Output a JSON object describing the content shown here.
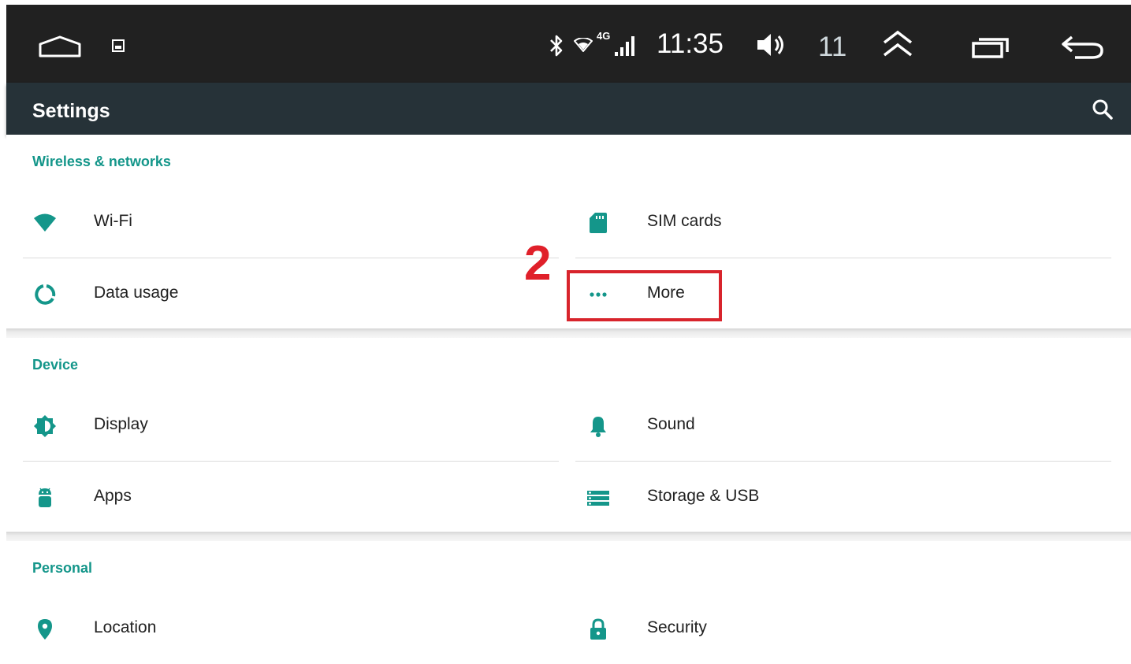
{
  "status_bar": {
    "time": "11:35",
    "network": "4G",
    "volume": "11",
    "icons": [
      "home-icon",
      "image-notification-icon",
      "bluetooth-icon",
      "wifi-icon",
      "cell-signal-icon",
      "speaker-icon",
      "expand-up-icon",
      "recent-apps-icon",
      "back-icon"
    ]
  },
  "app_bar": {
    "title": "Settings",
    "search_icon": "search-icon"
  },
  "sections": [
    {
      "header": "Wireless & networks",
      "items": [
        {
          "label": "Wi-Fi",
          "icon": "wifi-icon"
        },
        {
          "label": "SIM cards",
          "icon": "sim-card-icon"
        },
        {
          "label": "Data usage",
          "icon": "data-usage-icon"
        },
        {
          "label": "More",
          "icon": "more-dots-icon"
        }
      ]
    },
    {
      "header": "Device",
      "items": [
        {
          "label": "Display",
          "icon": "brightness-icon"
        },
        {
          "label": "Sound",
          "icon": "bell-icon"
        },
        {
          "label": "Apps",
          "icon": "android-icon"
        },
        {
          "label": "Storage & USB",
          "icon": "storage-icon"
        }
      ]
    },
    {
      "header": "Personal",
      "items": [
        {
          "label": "Location",
          "icon": "location-pin-icon"
        },
        {
          "label": "Security",
          "icon": "lock-icon"
        }
      ]
    }
  ],
  "annotation": {
    "step_number": "2",
    "highlight_color": "#d8242c"
  },
  "colors": {
    "accent": "#14968a",
    "status_bar": "#212121",
    "action_bar": "#263238"
  }
}
